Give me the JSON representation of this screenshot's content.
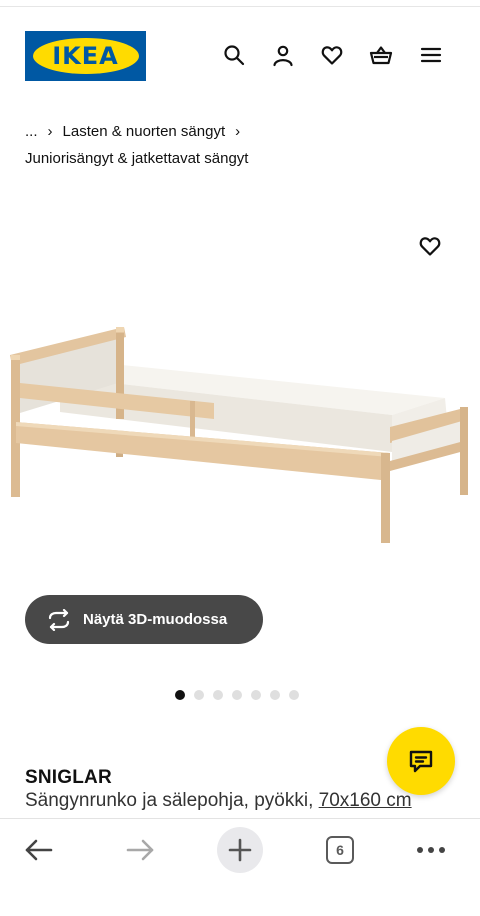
{
  "header": {
    "logo_text": "IKEA",
    "icons": [
      "search-icon",
      "account-icon",
      "favourites-icon",
      "basket-icon",
      "menu-icon"
    ]
  },
  "breadcrumb": {
    "ellipsis": "...",
    "separator": "›",
    "parent": "Lasten & nuorten sängyt",
    "current": "Juniorisängyt & jatkettavat sängyt"
  },
  "product": {
    "name": "SNIGLAR",
    "description": "Sängynrunko ja sälepohja, pyökki,",
    "size": "70x160 cm",
    "view_3d_label": "Näytä 3D-muodossa",
    "image_count": 7,
    "active_image_index": 0
  },
  "browser_bar": {
    "tab_count": "6",
    "icons": [
      "back-arrow-icon",
      "forward-arrow-icon",
      "plus-icon",
      "tabs-icon",
      "more-icon"
    ]
  },
  "colors": {
    "ikea_blue": "#0058a3",
    "ikea_yellow": "#ffdb00",
    "button_dark": "#484848"
  }
}
